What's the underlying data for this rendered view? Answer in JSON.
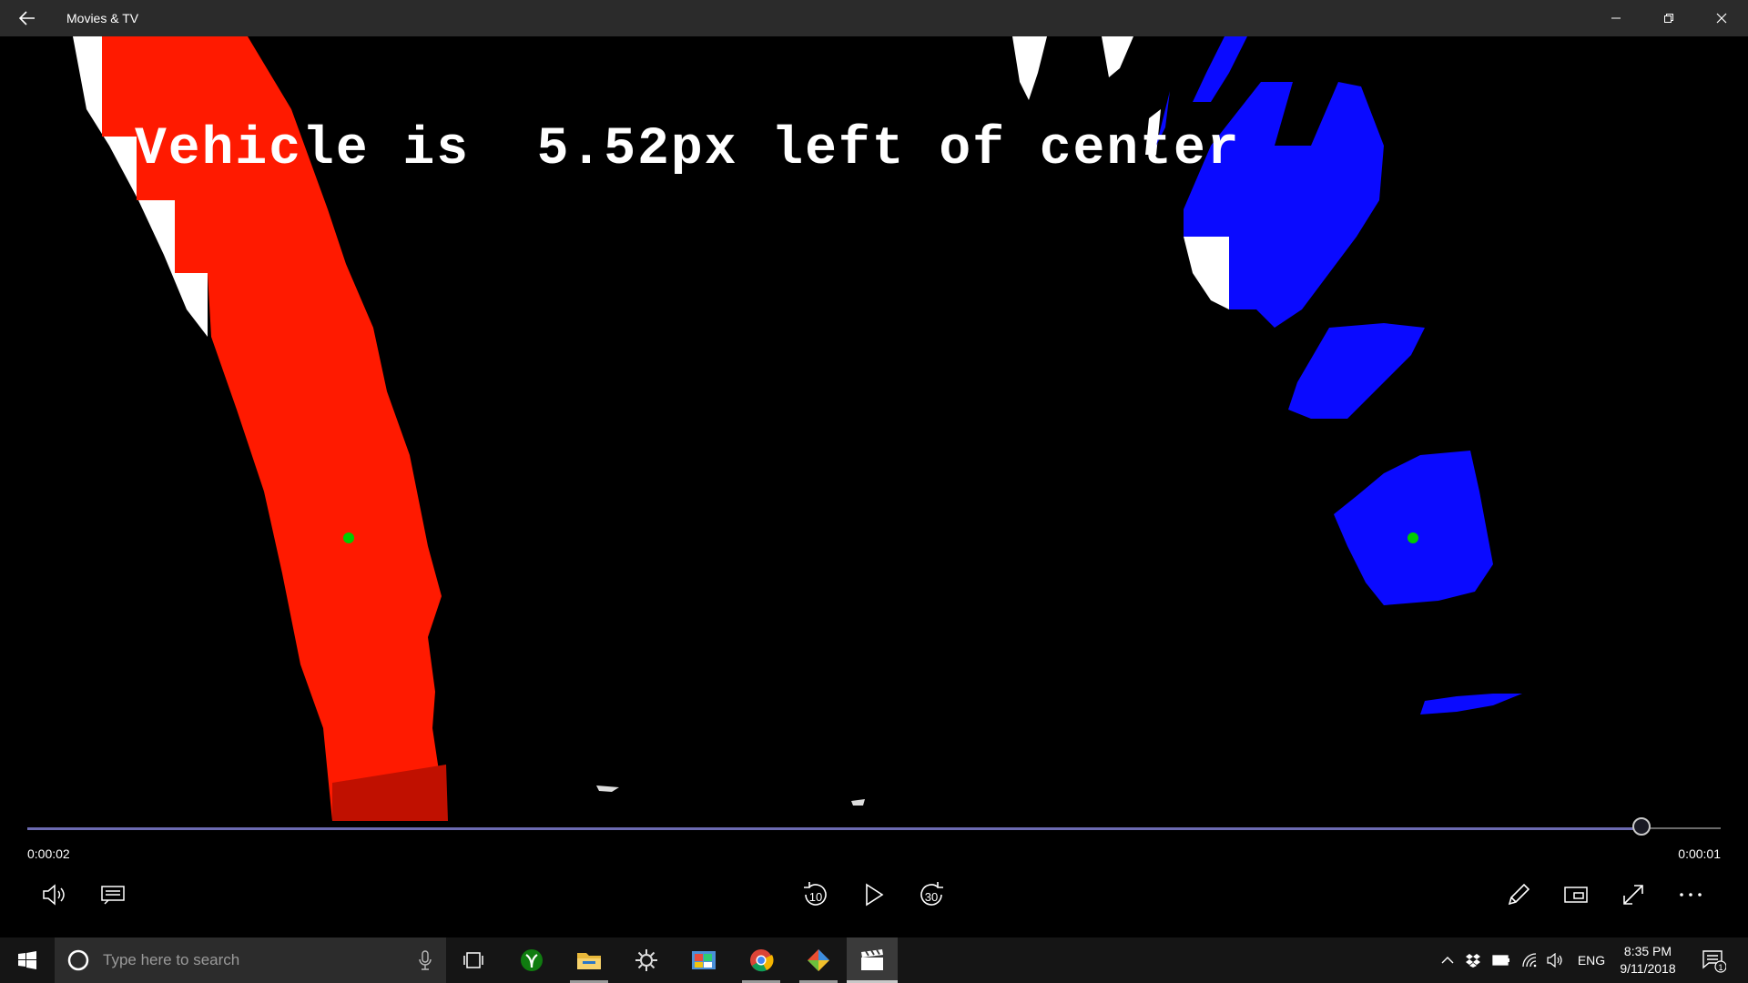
{
  "window": {
    "title": "Movies & TV"
  },
  "video": {
    "overlay_text": "Vehicle is  5.52px left of center",
    "colors": {
      "left_lane": "#ff1a00",
      "right_lane": "#0a0aff",
      "center_marker": "#00cc00"
    }
  },
  "player": {
    "elapsed": "0:00:02",
    "remaining": "0:00:01",
    "progress_fraction": 0.953,
    "skip_back_label": "10",
    "skip_forward_label": "30",
    "accent_color": "#6b6ab0"
  },
  "taskbar": {
    "search_placeholder": "Type here to search",
    "language": "ENG",
    "time": "8:35 PM",
    "date": "9/11/2018",
    "notification_count": "1"
  }
}
